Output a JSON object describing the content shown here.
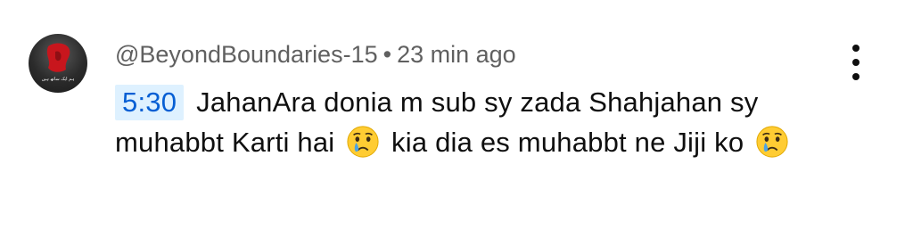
{
  "comment": {
    "author": "@BeyondBoundaries-15",
    "separator": "•",
    "time_ago": "23 min ago",
    "timestamp_link": "5:30",
    "text_part1": "JahanAra donia m sub sy zada Shahjahan sy muhabbt Karti hai",
    "text_part2": "kia dia es muhabbt ne Jiji ko",
    "emoji_1": "crying-face-emoji",
    "emoji_2": "crying-face-emoji"
  },
  "avatar": {
    "icon": "channel-avatar",
    "caption": "ہم ایک ساتھ ہیں"
  },
  "menu": {
    "icon": "more-vertical-icon"
  },
  "colors": {
    "timestamp_bg": "#def1ff",
    "timestamp_text": "#065fd4",
    "meta_text": "#606060",
    "body_text": "#0f0f0f"
  }
}
